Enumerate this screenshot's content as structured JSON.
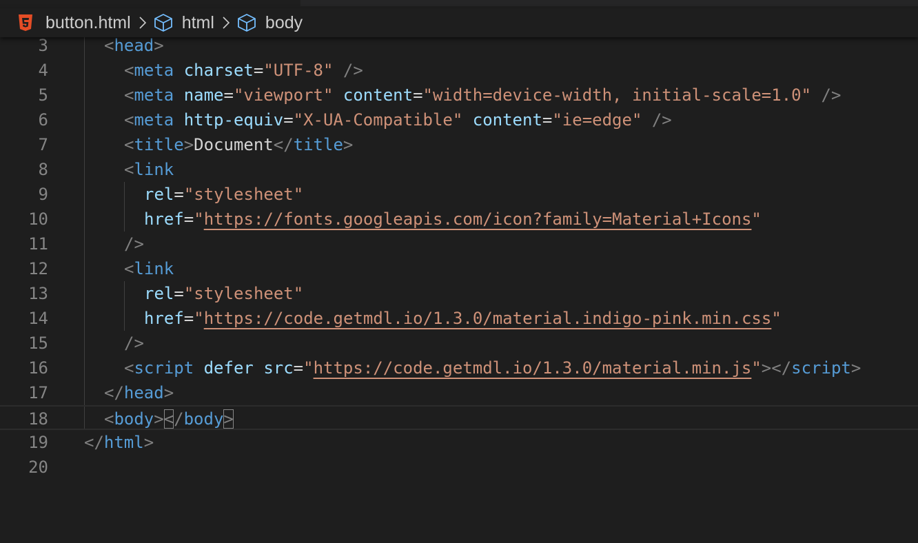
{
  "breadcrumbs": {
    "file_label": "button.html",
    "file_icon": "html5-icon",
    "items": [
      {
        "label": "html",
        "icon": "cube-icon"
      },
      {
        "label": "body",
        "icon": "cube-icon"
      }
    ]
  },
  "colors": {
    "background": "#1e1e1e",
    "line_number": "#858585",
    "tag": "#569cd6",
    "attribute": "#9cdcfe",
    "string": "#ce9178",
    "punctuation": "#808080",
    "text": "#d4d4d4",
    "html5_icon": "#e44d26"
  },
  "editor": {
    "current_line": 18,
    "lines": [
      {
        "number": "3",
        "tokens": [
          {
            "t": "punc",
            "v": "<"
          },
          {
            "t": "tag",
            "v": "head"
          },
          {
            "t": "punc",
            "v": ">"
          }
        ]
      },
      {
        "number": "4",
        "tokens": [
          {
            "t": "punc",
            "v": "<"
          },
          {
            "t": "tag",
            "v": "meta"
          },
          {
            "t": "text",
            "v": " "
          },
          {
            "t": "attr",
            "v": "charset"
          },
          {
            "t": "eq",
            "v": "="
          },
          {
            "t": "str",
            "v": "\"UTF-8\""
          },
          {
            "t": "text",
            "v": " "
          },
          {
            "t": "punc",
            "v": "/>"
          }
        ]
      },
      {
        "number": "5",
        "tokens": [
          {
            "t": "punc",
            "v": "<"
          },
          {
            "t": "tag",
            "v": "meta"
          },
          {
            "t": "text",
            "v": " "
          },
          {
            "t": "attr",
            "v": "name"
          },
          {
            "t": "eq",
            "v": "="
          },
          {
            "t": "str",
            "v": "\"viewport\""
          },
          {
            "t": "text",
            "v": " "
          },
          {
            "t": "attr",
            "v": "content"
          },
          {
            "t": "eq",
            "v": "="
          },
          {
            "t": "str",
            "v": "\"width=device-width, initial-scale=1.0\""
          },
          {
            "t": "text",
            "v": " "
          },
          {
            "t": "punc",
            "v": "/>"
          }
        ]
      },
      {
        "number": "6",
        "tokens": [
          {
            "t": "punc",
            "v": "<"
          },
          {
            "t": "tag",
            "v": "meta"
          },
          {
            "t": "text",
            "v": " "
          },
          {
            "t": "attr",
            "v": "http-equiv"
          },
          {
            "t": "eq",
            "v": "="
          },
          {
            "t": "str",
            "v": "\"X-UA-Compatible\""
          },
          {
            "t": "text",
            "v": " "
          },
          {
            "t": "attr",
            "v": "content"
          },
          {
            "t": "eq",
            "v": "="
          },
          {
            "t": "str",
            "v": "\"ie=edge\""
          },
          {
            "t": "text",
            "v": " "
          },
          {
            "t": "punc",
            "v": "/>"
          }
        ]
      },
      {
        "number": "7",
        "tokens": [
          {
            "t": "punc",
            "v": "<"
          },
          {
            "t": "tag",
            "v": "title"
          },
          {
            "t": "punc",
            "v": ">"
          },
          {
            "t": "text",
            "v": "Document"
          },
          {
            "t": "punc",
            "v": "</"
          },
          {
            "t": "tag",
            "v": "title"
          },
          {
            "t": "punc",
            "v": ">"
          }
        ]
      },
      {
        "number": "8",
        "tokens": [
          {
            "t": "punc",
            "v": "<"
          },
          {
            "t": "tag",
            "v": "link"
          }
        ]
      },
      {
        "number": "9",
        "tokens": [
          {
            "t": "attr",
            "v": "rel"
          },
          {
            "t": "eq",
            "v": "="
          },
          {
            "t": "str",
            "v": "\"stylesheet\""
          }
        ]
      },
      {
        "number": "10",
        "tokens": [
          {
            "t": "attr",
            "v": "href"
          },
          {
            "t": "eq",
            "v": "="
          },
          {
            "t": "str",
            "v": "\""
          },
          {
            "t": "url",
            "v": "https://fonts.googleapis.com/icon?family=Material+Icons"
          },
          {
            "t": "str",
            "v": "\""
          }
        ]
      },
      {
        "number": "11",
        "tokens": [
          {
            "t": "punc",
            "v": "/>"
          }
        ]
      },
      {
        "number": "12",
        "tokens": [
          {
            "t": "punc",
            "v": "<"
          },
          {
            "t": "tag",
            "v": "link"
          }
        ]
      },
      {
        "number": "13",
        "tokens": [
          {
            "t": "attr",
            "v": "rel"
          },
          {
            "t": "eq",
            "v": "="
          },
          {
            "t": "str",
            "v": "\"stylesheet\""
          }
        ]
      },
      {
        "number": "14",
        "tokens": [
          {
            "t": "attr",
            "v": "href"
          },
          {
            "t": "eq",
            "v": "="
          },
          {
            "t": "str",
            "v": "\""
          },
          {
            "t": "url",
            "v": "https://code.getmdl.io/1.3.0/material.indigo-pink.min.css"
          },
          {
            "t": "str",
            "v": "\""
          }
        ]
      },
      {
        "number": "15",
        "tokens": [
          {
            "t": "punc",
            "v": "/>"
          }
        ]
      },
      {
        "number": "16",
        "tokens": [
          {
            "t": "punc",
            "v": "<"
          },
          {
            "t": "tag",
            "v": "script"
          },
          {
            "t": "text",
            "v": " "
          },
          {
            "t": "attr",
            "v": "defer"
          },
          {
            "t": "text",
            "v": " "
          },
          {
            "t": "attr",
            "v": "src"
          },
          {
            "t": "eq",
            "v": "="
          },
          {
            "t": "str",
            "v": "\""
          },
          {
            "t": "url",
            "v": "https://code.getmdl.io/1.3.0/material.min.js"
          },
          {
            "t": "str",
            "v": "\""
          },
          {
            "t": "punc",
            "v": "></"
          },
          {
            "t": "tag",
            "v": "script"
          },
          {
            "t": "punc",
            "v": ">"
          }
        ]
      },
      {
        "number": "17",
        "tokens": [
          {
            "t": "punc",
            "v": "</"
          },
          {
            "t": "tag",
            "v": "head"
          },
          {
            "t": "punc",
            "v": ">"
          }
        ]
      },
      {
        "number": "18",
        "tokens": [
          {
            "t": "punc",
            "v": "<"
          },
          {
            "t": "tag",
            "v": "body"
          },
          {
            "t": "punc",
            "v": ">"
          },
          {
            "t": "punc",
            "v": "<",
            "box": true
          },
          {
            "t": "punc",
            "v": "/"
          },
          {
            "t": "tag",
            "v": "body"
          },
          {
            "t": "punc",
            "v": ">",
            "box": true
          }
        ]
      },
      {
        "number": "19",
        "tokens": [
          {
            "t": "punc",
            "v": "</"
          },
          {
            "t": "tag",
            "v": "html"
          },
          {
            "t": "punc",
            "v": ">"
          }
        ]
      },
      {
        "number": "20",
        "tokens": []
      }
    ]
  }
}
